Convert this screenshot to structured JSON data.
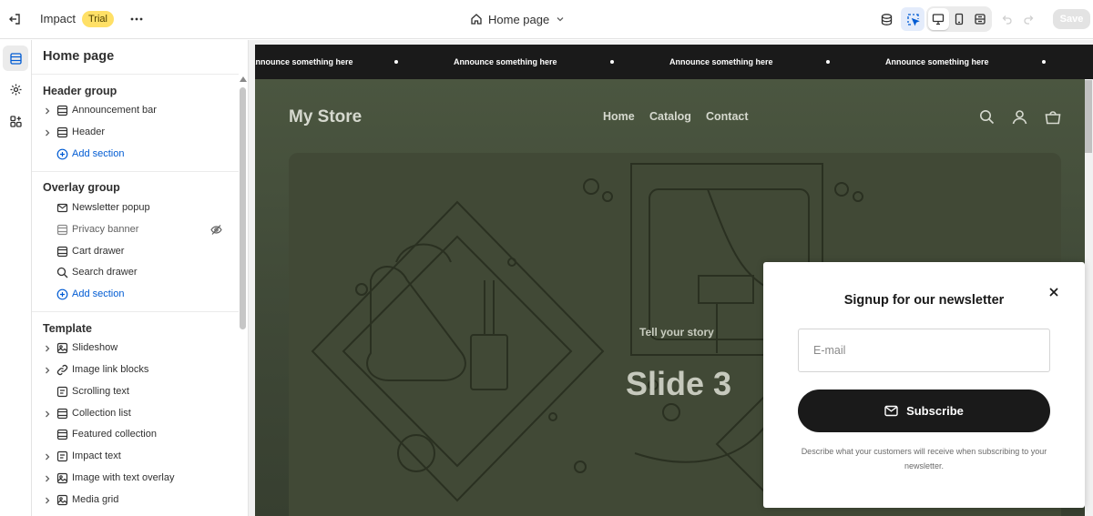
{
  "topbar": {
    "app_name": "Impact",
    "badge": "Trial",
    "page_selector": "Home page",
    "save_label": "Save"
  },
  "sidebar": {
    "title": "Home page",
    "groups": [
      {
        "title": "Header group",
        "items": [
          {
            "label": "Announcement bar",
            "icon": "section-icon",
            "expandable": true
          },
          {
            "label": "Header",
            "icon": "section-icon",
            "expandable": true
          },
          {
            "label": "Add section",
            "icon": "plus-circle-icon",
            "add": true
          }
        ]
      },
      {
        "title": "Overlay group",
        "items": [
          {
            "label": "Newsletter popup",
            "icon": "email-icon"
          },
          {
            "label": "Privacy banner",
            "icon": "section-icon",
            "hidden": true
          },
          {
            "label": "Cart drawer",
            "icon": "section-icon"
          },
          {
            "label": "Search drawer",
            "icon": "search-icon"
          },
          {
            "label": "Add section",
            "icon": "plus-circle-icon",
            "add": true
          }
        ]
      },
      {
        "title": "Template",
        "items": [
          {
            "label": "Slideshow",
            "icon": "slideshow-icon",
            "expandable": true
          },
          {
            "label": "Image link blocks",
            "icon": "link-icon",
            "expandable": true
          },
          {
            "label": "Scrolling text",
            "icon": "text-icon"
          },
          {
            "label": "Collection list",
            "icon": "section-icon",
            "expandable": true
          },
          {
            "label": "Featured collection",
            "icon": "section-icon"
          },
          {
            "label": "Impact text",
            "icon": "text-icon",
            "expandable": true
          },
          {
            "label": "Image with text overlay",
            "icon": "image-icon",
            "expandable": true
          },
          {
            "label": "Media grid",
            "icon": "image-icon",
            "expandable": true
          }
        ]
      }
    ]
  },
  "preview": {
    "announcement": "Announce something here",
    "store": {
      "logo": "My Store",
      "nav": [
        "Home",
        "Catalog",
        "Contact"
      ]
    },
    "hero": {
      "subheading": "Tell your story",
      "heading": "Slide 3"
    },
    "popup": {
      "title": "Signup for our newsletter",
      "email_placeholder": "E-mail",
      "button": "Subscribe",
      "description": "Describe what your customers will receive when subscribing to your newsletter."
    }
  },
  "colors": {
    "accent": "#005bd3",
    "badge_bg": "#ffe066",
    "announcement_bg": "#1a1a1a",
    "store_bg": "#3e4736"
  }
}
